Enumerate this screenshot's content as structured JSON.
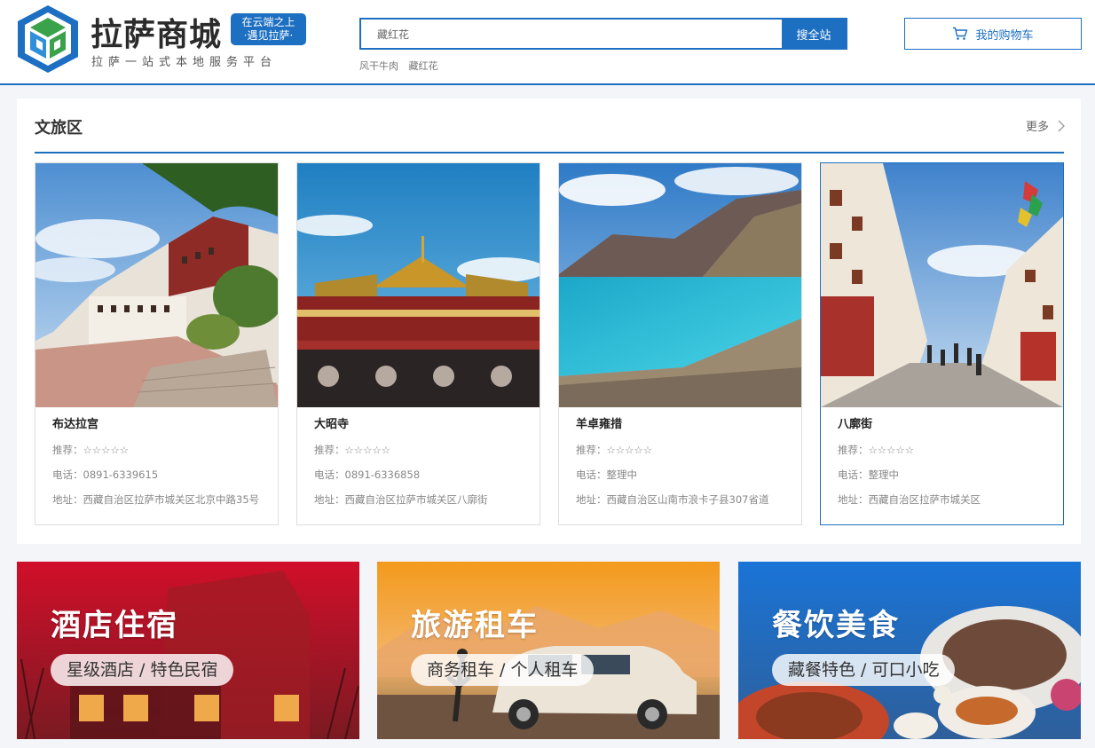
{
  "header": {
    "brand_name": "拉萨商城",
    "badge_line1": "在云端之上",
    "badge_line2": "·遇见拉萨·",
    "slogan": "拉萨一站式本地服务平台",
    "search_value": "藏红花",
    "search_button": "搜全站",
    "hot_keywords": [
      "风干牛肉",
      "藏红花"
    ],
    "cart_label": "我的购物车"
  },
  "culture": {
    "title": "文旅区",
    "more": "更多",
    "cards": [
      {
        "name": "布达拉宫",
        "rating": "推荐：☆☆☆☆☆",
        "phone": "电话：0891-6339615",
        "address": "地址：西藏自治区拉萨市城关区北京中路35号"
      },
      {
        "name": "大昭寺",
        "rating": "推荐：☆☆☆☆☆",
        "phone": "电话：0891-6336858",
        "address": "地址：西藏自治区拉萨市城关区八廓街"
      },
      {
        "name": "羊卓雍措",
        "rating": "推荐：☆☆☆☆☆",
        "phone": "电话：整理中",
        "address": "地址：西藏自治区山南市浪卡子县307省道"
      },
      {
        "name": "八廓街",
        "rating": "推荐：☆☆☆☆☆",
        "phone": "电话：整理中",
        "address": "地址：西藏自治区拉萨市城关区"
      }
    ]
  },
  "banners": [
    {
      "title": "酒店住宿",
      "subtitle": "星级酒店 / 特色民宿"
    },
    {
      "title": "旅游租车",
      "subtitle": "商务租车 / 个人租车"
    },
    {
      "title": "餐饮美食",
      "subtitle": "藏餐特色 / 可口小吃"
    }
  ],
  "colors": {
    "brand": "#1d6fc2",
    "hotel": "#c8102e",
    "car": "#f08a1c",
    "food": "#1a72d4"
  },
  "icons": {
    "logo": "cube-logo-icon",
    "cart": "cart-icon",
    "more": "chevron-right-icon"
  }
}
